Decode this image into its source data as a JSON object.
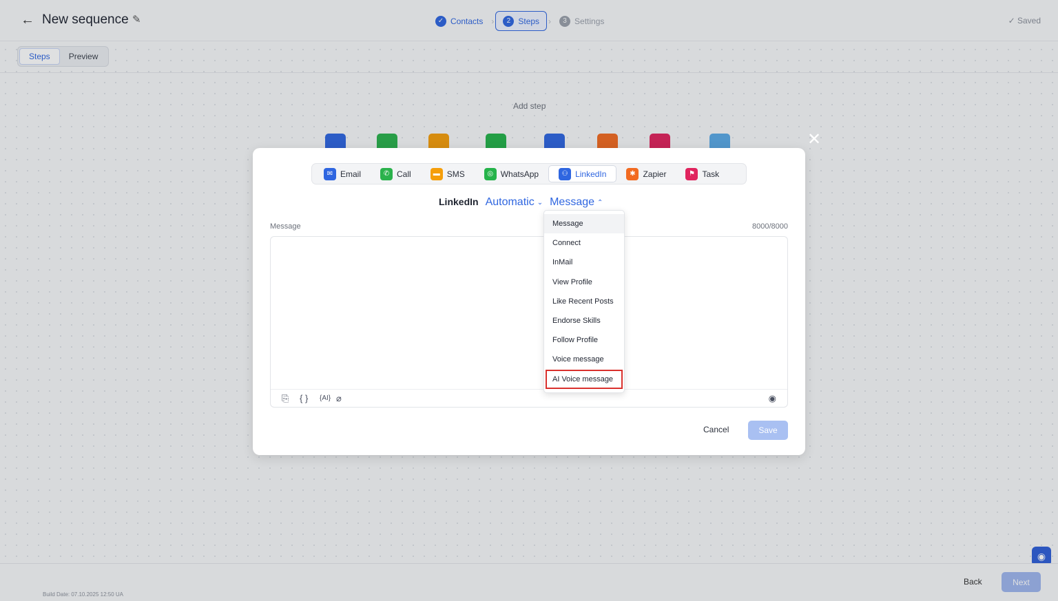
{
  "header": {
    "title": "New sequence",
    "saved": "✓ Saved",
    "steps": [
      {
        "label": "Contacts",
        "num": "✓"
      },
      {
        "label": "Steps",
        "num": "2"
      },
      {
        "label": "Settings",
        "num": "3"
      }
    ]
  },
  "view_tabs": [
    "Steps",
    "Preview"
  ],
  "canvas": {
    "add_step": "Add step"
  },
  "modal": {
    "channels": [
      {
        "label": "Email",
        "color": "#2f66e0",
        "glyph": "✉"
      },
      {
        "label": "Call",
        "color": "#2bb24c",
        "glyph": "✆"
      },
      {
        "label": "SMS",
        "color": "#f59e0b",
        "glyph": "▬"
      },
      {
        "label": "WhatsApp",
        "color": "#25b34a",
        "glyph": "◎"
      },
      {
        "label": "LinkedIn",
        "color": "#2f66e0",
        "glyph": "⚇"
      },
      {
        "label": "Zapier",
        "color": "#f26b21",
        "glyph": "✱"
      },
      {
        "label": "Task",
        "color": "#e0245e",
        "glyph": "⚑"
      }
    ],
    "channel_label": "LinkedIn",
    "mode_select": "Automatic",
    "type_select": "Message",
    "message_label": "Message",
    "char_count": "8000/8000",
    "cancel": "Cancel",
    "save": "Save"
  },
  "dropdown": {
    "items": [
      "Message",
      "Connect",
      "InMail",
      "View Profile",
      "Like Recent Posts",
      "Endorse Skills",
      "Follow Profile",
      "Voice message",
      "AI Voice message"
    ]
  },
  "footer": {
    "build": "Build Date: 07.10.2025 12:50 UA",
    "back": "Back",
    "next": "Next"
  }
}
